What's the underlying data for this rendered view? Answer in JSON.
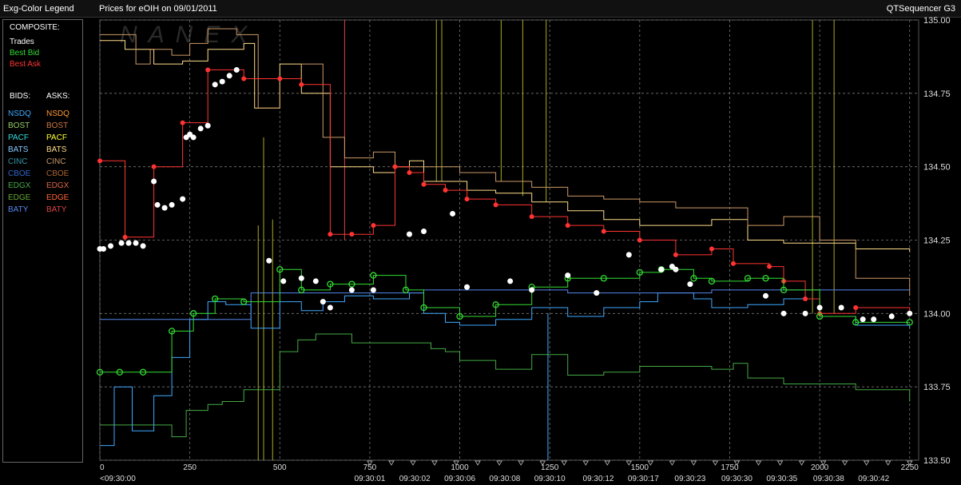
{
  "header": {
    "legend_title": "Exg-Color Legend",
    "chart_title": "Prices for  eOIH  on  09/01/2011",
    "app_name": "QTSequencer G3"
  },
  "legend": {
    "composite_label": "COMPOSITE:",
    "composite": [
      {
        "label": "Trades",
        "color": "#ffffff"
      },
      {
        "label": "Best Bid",
        "color": "#33dd33"
      },
      {
        "label": "Best Ask",
        "color": "#ff3333"
      }
    ],
    "bids_label": "BIDS:",
    "asks_label": "ASKS:",
    "bids": [
      {
        "label": "NSDQ",
        "color": "#3fa9ff"
      },
      {
        "label": "BOST",
        "color": "#99cc66"
      },
      {
        "label": "PACF",
        "color": "#33dddd"
      },
      {
        "label": "BATS",
        "color": "#88ccff"
      },
      {
        "label": "CINC",
        "color": "#3399aa"
      },
      {
        "label": "CBOE",
        "color": "#3366cc"
      },
      {
        "label": "EDGX",
        "color": "#44aa44"
      },
      {
        "label": "EDGE",
        "color": "#66aa33"
      },
      {
        "label": "BATY",
        "color": "#5588ee"
      }
    ],
    "asks": [
      {
        "label": "NSDQ",
        "color": "#ff9933"
      },
      {
        "label": "BOST",
        "color": "#cc7744"
      },
      {
        "label": "PACF",
        "color": "#ffff33"
      },
      {
        "label": "BATS",
        "color": "#ffdd88"
      },
      {
        "label": "CINC",
        "color": "#cc9966"
      },
      {
        "label": "CBOE",
        "color": "#aa6633"
      },
      {
        "label": "EDGX",
        "color": "#dd6644"
      },
      {
        "label": "EDGE",
        "color": "#ff6633"
      },
      {
        "label": "BATY",
        "color": "#dd4444"
      }
    ]
  },
  "chart_data": {
    "type": "line",
    "watermark": "NANEX",
    "ylim": [
      133.5,
      135.0
    ],
    "y_ticks": [
      "133.50",
      "133.75",
      "134.00",
      "134.25",
      "134.50",
      "134.75",
      "135.00"
    ],
    "xlim": [
      0,
      2275
    ],
    "x_ticks": [
      0,
      250,
      500,
      750,
      1000,
      1250,
      1500,
      1750,
      2000,
      2250
    ],
    "time_labels": [
      {
        "x": 0,
        "label": "<09:30:00"
      },
      {
        "x": 750,
        "label": "09:30:01"
      },
      {
        "x": 875,
        "label": "09:30:02"
      },
      {
        "x": 1000,
        "label": "09:30:06"
      },
      {
        "x": 1125,
        "label": "09:30:08"
      },
      {
        "x": 1250,
        "label": "09:30:10"
      },
      {
        "x": 1385,
        "label": "09:30:12"
      },
      {
        "x": 1510,
        "label": "09:30:17"
      },
      {
        "x": 1640,
        "label": "09:30:23"
      },
      {
        "x": 1770,
        "label": "09:30:30"
      },
      {
        "x": 1895,
        "label": "09:30:35"
      },
      {
        "x": 2025,
        "label": "09:30:38"
      },
      {
        "x": 2150,
        "label": "09:30:42"
      }
    ],
    "grid": true,
    "series": [
      {
        "name": "Best Ask",
        "color": "#ff3333",
        "x": [
          0,
          70,
          150,
          230,
          300,
          400,
          500,
          560,
          640,
          700,
          760,
          820,
          860,
          900,
          960,
          1020,
          1100,
          1200,
          1300,
          1400,
          1500,
          1600,
          1700,
          1760,
          1860,
          1900,
          1960,
          2000,
          2100,
          2250
        ],
        "y": [
          134.52,
          134.26,
          134.5,
          134.65,
          134.83,
          134.8,
          134.8,
          134.78,
          134.27,
          134.27,
          134.3,
          134.5,
          134.48,
          134.44,
          134.42,
          134.39,
          134.37,
          134.33,
          134.3,
          134.28,
          134.25,
          134.2,
          134.22,
          134.17,
          134.16,
          134.11,
          134.05,
          134.0,
          134.02,
          134.0
        ]
      },
      {
        "name": "Best Bid",
        "color": "#33dd33",
        "x": [
          0,
          55,
          120,
          200,
          260,
          320,
          400,
          500,
          560,
          640,
          700,
          760,
          850,
          900,
          1000,
          1100,
          1200,
          1300,
          1400,
          1500,
          1560,
          1650,
          1700,
          1800,
          1850,
          1900,
          2000,
          2100,
          2250
        ],
        "y": [
          133.8,
          133.8,
          133.8,
          133.94,
          134.0,
          134.05,
          134.04,
          134.15,
          134.08,
          134.1,
          134.1,
          134.13,
          134.08,
          134.02,
          133.99,
          134.03,
          134.09,
          134.12,
          134.12,
          134.14,
          134.15,
          134.12,
          134.11,
          134.12,
          134.12,
          134.08,
          133.99,
          133.97,
          133.97
        ]
      },
      {
        "name": "BATS",
        "color": "#ffdd88",
        "x": [
          0,
          70,
          150,
          230,
          300,
          400,
          430,
          500,
          560,
          640,
          700,
          760,
          820,
          860,
          900,
          960,
          1020,
          1100,
          1200,
          1300,
          1400,
          1500,
          1600,
          1700,
          1800,
          1900,
          2000,
          2100,
          2250
        ],
        "y": [
          134.93,
          134.9,
          134.85,
          134.86,
          134.9,
          134.92,
          134.7,
          134.85,
          134.75,
          134.5,
          134.5,
          134.48,
          134.5,
          134.52,
          134.45,
          134.45,
          134.42,
          134.41,
          134.38,
          134.35,
          134.32,
          134.3,
          134.3,
          134.32,
          134.25,
          134.24,
          134.24,
          134.22,
          134.21
        ]
      },
      {
        "name": "CINC",
        "color": "#cc9966",
        "x": [
          0,
          50,
          100,
          140,
          200,
          250,
          300,
          380,
          440,
          500,
          560,
          620,
          680,
          760,
          820,
          900,
          1000,
          1100,
          1200,
          1300,
          1400,
          1500,
          1600,
          1700,
          1800,
          1900,
          2000,
          2100,
          2250
        ],
        "y": [
          134.95,
          134.95,
          134.85,
          134.9,
          134.88,
          134.92,
          134.97,
          134.95,
          134.7,
          134.8,
          134.85,
          134.6,
          134.53,
          134.55,
          134.5,
          134.5,
          134.48,
          134.45,
          134.43,
          134.4,
          134.39,
          134.38,
          134.36,
          134.36,
          134.3,
          134.33,
          134.25,
          134.12,
          134.06
        ]
      },
      {
        "name": "EDGX",
        "color": "#44aa44",
        "x": [
          0,
          100,
          200,
          240,
          300,
          340,
          400,
          500,
          550,
          600,
          700,
          760,
          860,
          920,
          960,
          1000,
          1100,
          1200,
          1300,
          1400,
          1500,
          1600,
          1700,
          1760,
          1800,
          1900,
          2000,
          2100,
          2250
        ],
        "y": [
          133.62,
          133.62,
          133.58,
          133.67,
          133.69,
          133.7,
          133.74,
          133.87,
          133.91,
          133.93,
          133.9,
          133.9,
          133.9,
          133.88,
          133.87,
          133.84,
          133.81,
          133.86,
          133.79,
          133.8,
          133.82,
          133.82,
          133.81,
          133.83,
          133.78,
          133.76,
          133.76,
          133.74,
          133.7
        ]
      },
      {
        "name": "NSDQ",
        "color": "#3fa9ff",
        "x": [
          0,
          40,
          90,
          150,
          200,
          250,
          300,
          350,
          420,
          500,
          560,
          620,
          680,
          760,
          860,
          900,
          960,
          1000,
          1100,
          1200,
          1300,
          1400,
          1500,
          1550,
          1650,
          1700,
          1800,
          1900,
          2000,
          2100,
          2250
        ],
        "y": [
          133.55,
          133.75,
          133.6,
          133.72,
          133.85,
          133.98,
          134.04,
          134.03,
          133.95,
          134.04,
          134.01,
          134.04,
          134.06,
          134.05,
          134.07,
          134.0,
          133.97,
          133.96,
          133.98,
          134.02,
          133.99,
          134.02,
          134.04,
          134.07,
          134.05,
          134.02,
          134.03,
          134.05,
          133.99,
          133.96,
          133.95
        ]
      },
      {
        "name": "BATY",
        "color": "#5588ee",
        "x": [
          0,
          300,
          420,
          500,
          700,
          900,
          1100,
          1300,
          1500,
          1700,
          1900,
          2100,
          2250
        ],
        "y": [
          133.98,
          133.98,
          134.07,
          134.07,
          134.07,
          134.08,
          134.08,
          134.07,
          134.07,
          134.08,
          134.08,
          134.08,
          134.08
        ]
      }
    ],
    "spikes": [
      {
        "x": 440,
        "y0": 133.5,
        "y1": 134.3,
        "color": "#aaaa22"
      },
      {
        "x": 455,
        "y0": 133.5,
        "y1": 134.6,
        "color": "#aaaa22"
      },
      {
        "x": 480,
        "y0": 133.5,
        "y1": 134.32,
        "color": "#aaaa22"
      },
      {
        "x": 680,
        "y0": 134.25,
        "y1": 135.0,
        "color": "#dd4444"
      },
      {
        "x": 935,
        "y0": 134.45,
        "y1": 135.0,
        "color": "#aaaa22"
      },
      {
        "x": 950,
        "y0": 134.45,
        "y1": 135.0,
        "color": "#aaaa22"
      },
      {
        "x": 1115,
        "y0": 134.45,
        "y1": 135.0,
        "color": "#aaaa22"
      },
      {
        "x": 1175,
        "y0": 134.4,
        "y1": 135.0,
        "color": "#aaaa22"
      },
      {
        "x": 1240,
        "y0": 134.38,
        "y1": 135.0,
        "color": "#aaaa22"
      },
      {
        "x": 1245,
        "y0": 133.5,
        "y1": 134.0,
        "color": "#3fa9ff"
      },
      {
        "x": 1980,
        "y0": 134.0,
        "y1": 135.0,
        "color": "#aaaa22"
      },
      {
        "x": 2040,
        "y0": 134.0,
        "y1": 135.0,
        "color": "#aaaa22"
      }
    ],
    "trades": {
      "color": "#ffffff",
      "x": [
        0,
        10,
        30,
        60,
        80,
        100,
        120,
        150,
        160,
        180,
        200,
        230,
        240,
        250,
        260,
        280,
        300,
        320,
        340,
        360,
        380,
        470,
        510,
        560,
        600,
        620,
        640,
        700,
        760,
        860,
        900,
        980,
        1020,
        1140,
        1200,
        1300,
        1380,
        1470,
        1560,
        1590,
        1600,
        1640,
        1850,
        1900,
        1960,
        2000,
        2060,
        2120,
        2150,
        2200,
        2250
      ],
      "y": [
        134.22,
        134.22,
        134.23,
        134.24,
        134.24,
        134.24,
        134.23,
        134.45,
        134.37,
        134.36,
        134.37,
        134.39,
        134.6,
        134.61,
        134.6,
        134.63,
        134.64,
        134.78,
        134.79,
        134.81,
        134.83,
        134.18,
        134.11,
        134.12,
        134.11,
        134.04,
        134.02,
        134.08,
        134.08,
        134.27,
        134.28,
        134.34,
        134.09,
        134.11,
        134.08,
        134.13,
        134.07,
        134.2,
        134.15,
        134.16,
        134.15,
        134.1,
        134.06,
        134.0,
        134.0,
        134.02,
        134.02,
        133.98,
        133.98,
        133.99,
        134.0
      ]
    }
  }
}
